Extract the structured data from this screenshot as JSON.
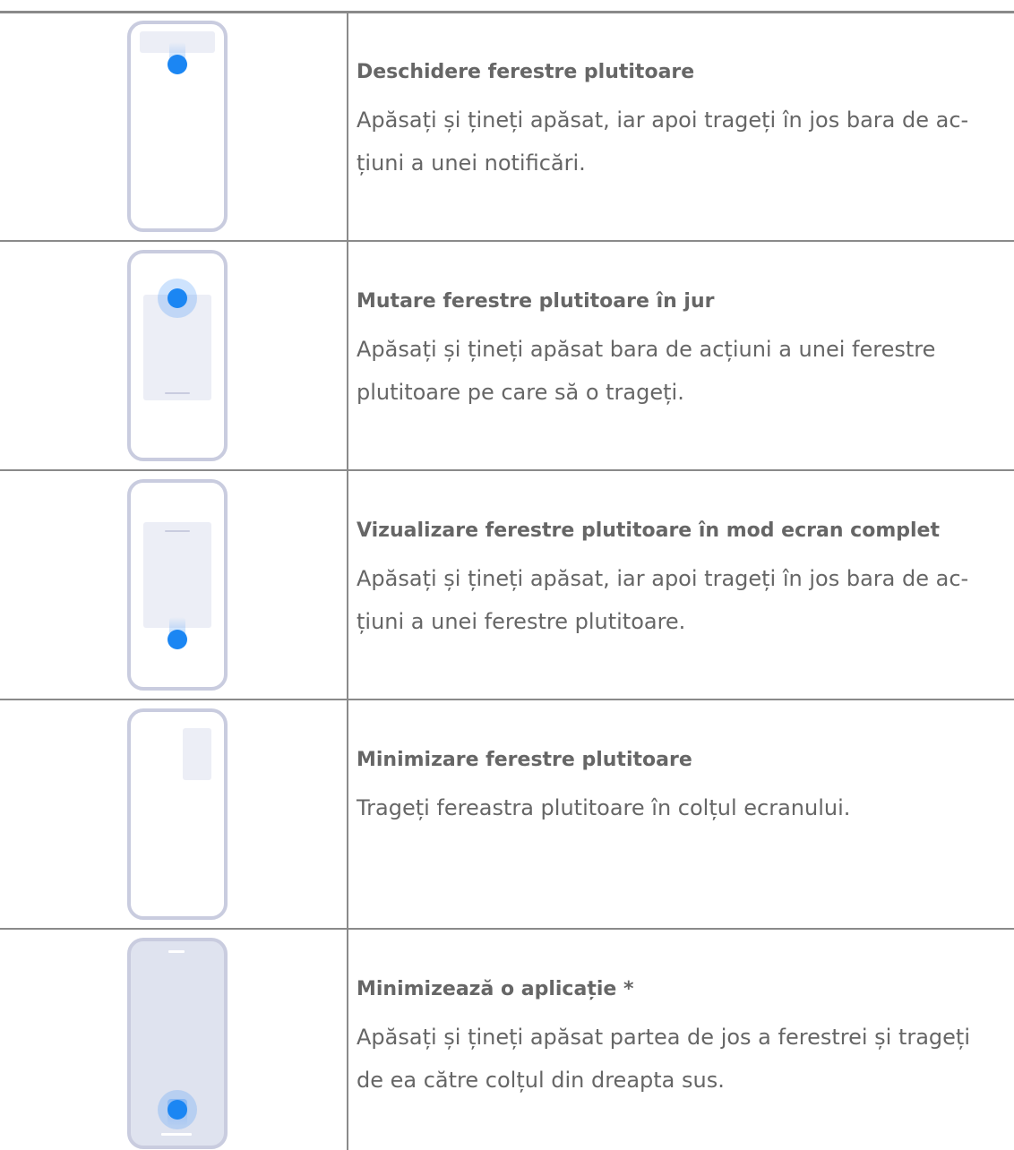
{
  "accent_color": "#1b86f3",
  "rows": [
    {
      "icon": "phone-notification-drag-icon",
      "title": "Deschidere ferestre plutitoare",
      "desc1": "Apăsați și țineți apăsat, iar apoi trageți în jos bara de ac-",
      "desc2": "țiuni a unei notificări."
    },
    {
      "icon": "phone-move-window-icon",
      "title": "Mutare ferestre plutitoare în jur",
      "desc1": "Apăsați și țineți apăsat bara de acțiuni a unei ferestre",
      "desc2": "plutitoare pe care să o trageți."
    },
    {
      "icon": "phone-fullscreen-window-icon",
      "title": "Vizualizare ferestre plutitoare în mod ecran complet",
      "desc1": "Apăsați și țineți apăsat, iar apoi trageți în jos bara de ac-",
      "desc2": "țiuni a unei ferestre plutitoare."
    },
    {
      "icon": "phone-minimize-window-icon",
      "title": "Minimizare ferestre plutitoare",
      "desc1": "Trageți fereastra plutitoare în colțul ecranului.",
      "desc2": ""
    },
    {
      "icon": "phone-minimize-app-icon",
      "title": "Minimizează o aplicație *",
      "desc1": "Apăsați și țineți apăsat partea de jos a ferestrei și trageți",
      "desc2": "de ea către colțul din dreapta sus."
    }
  ]
}
